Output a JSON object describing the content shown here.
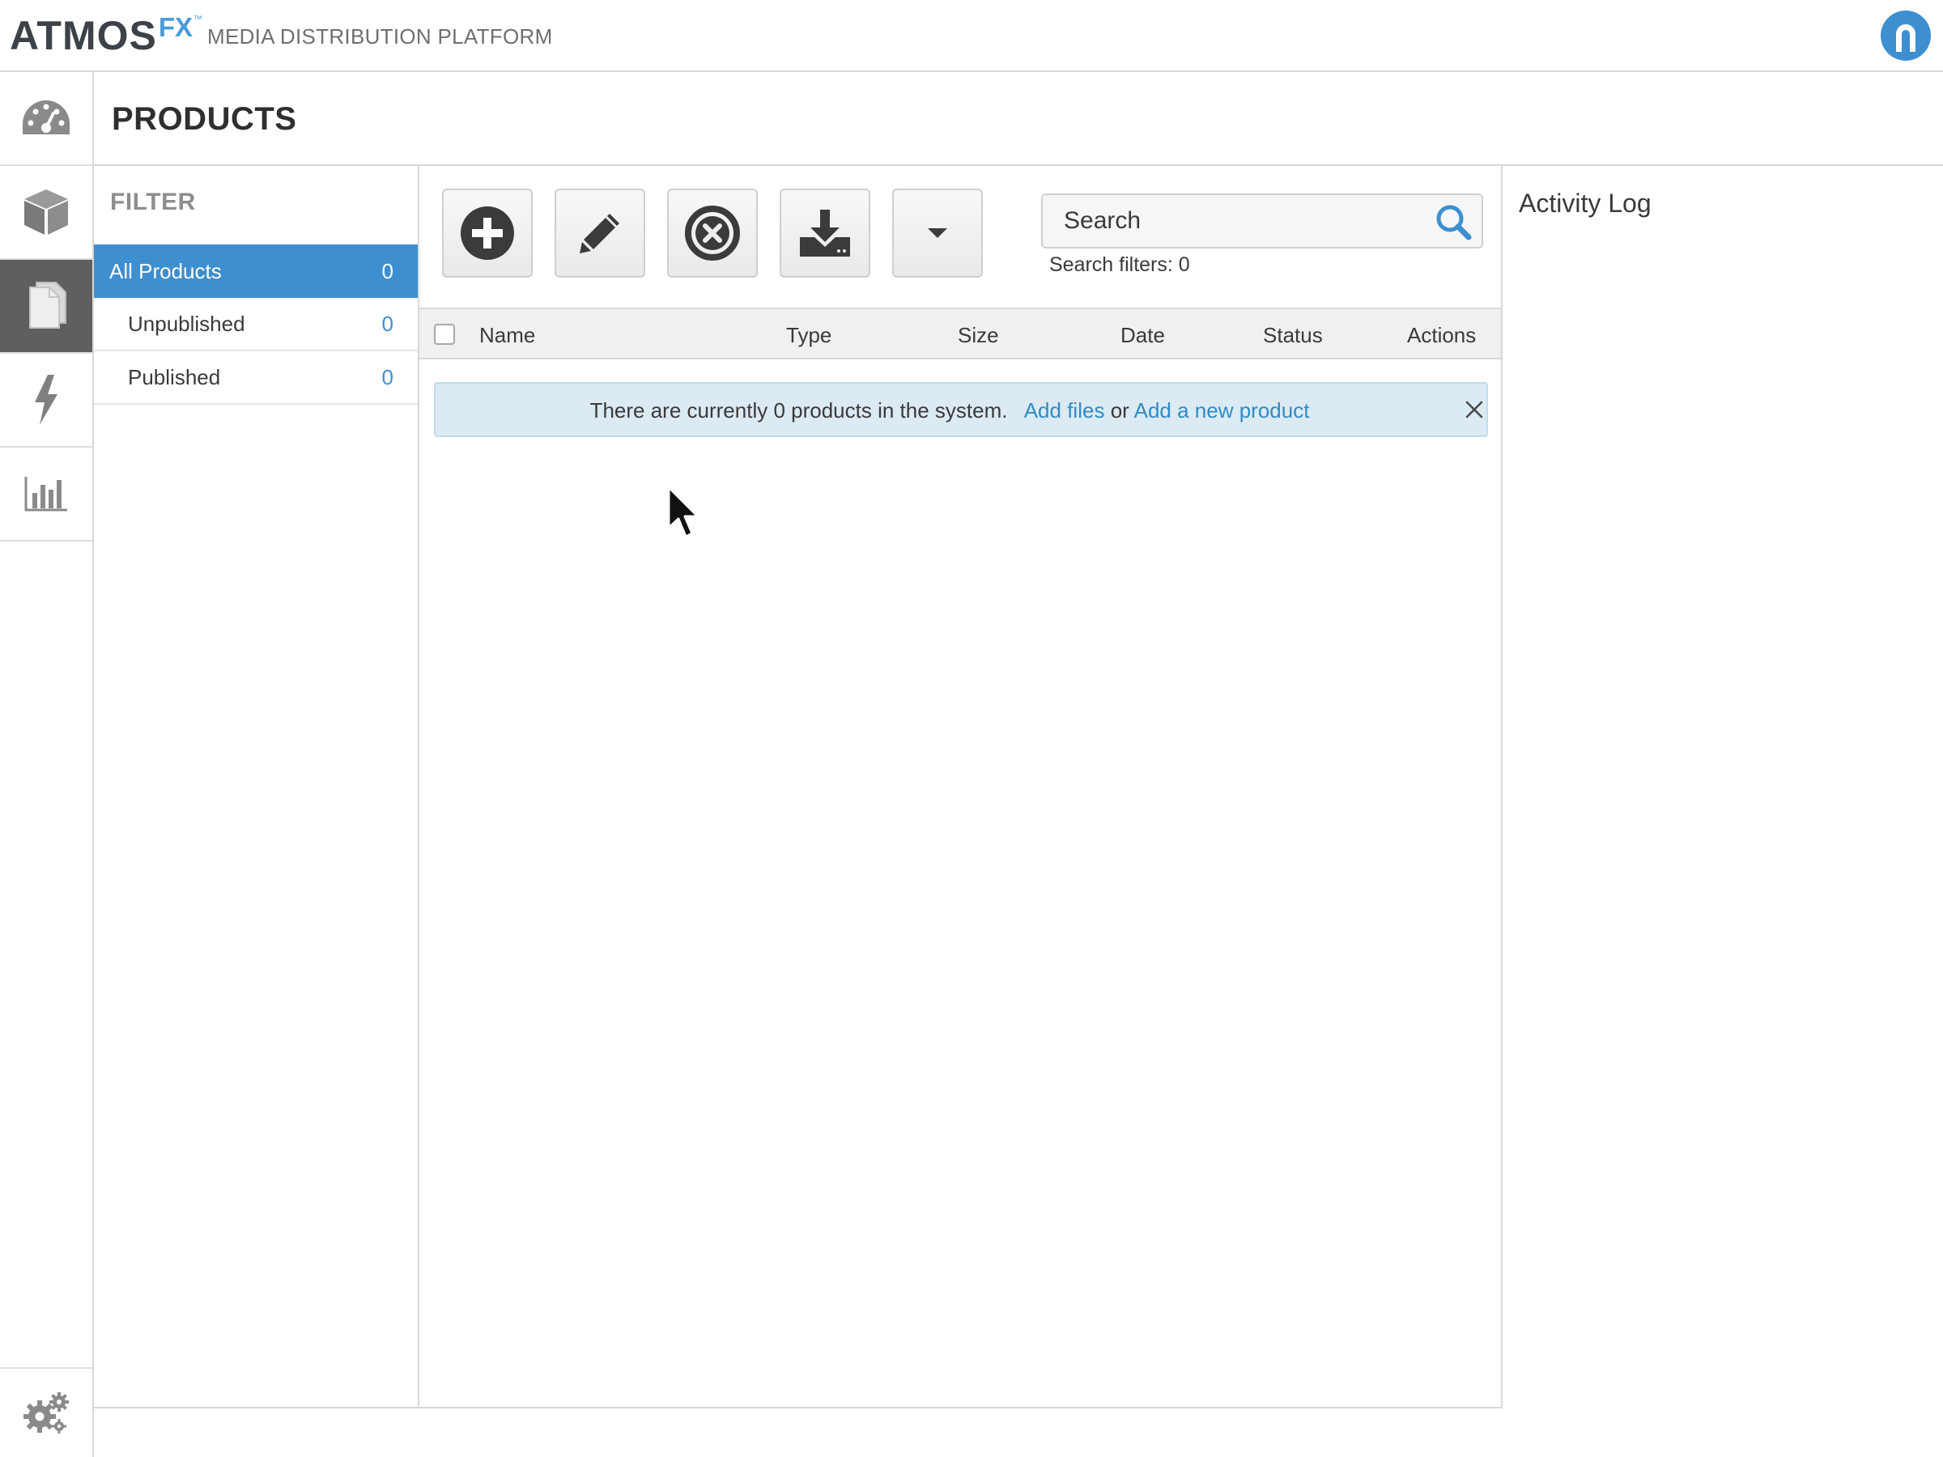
{
  "header": {
    "logo_main": "ATMOS",
    "logo_fx": "FX",
    "logo_tm": "™",
    "platform": "MEDIA DISTRIBUTION PLATFORM",
    "user_icon": "user-avatar-icon"
  },
  "rail": {
    "items": [
      {
        "icon": "dashboard-icon",
        "active": false
      },
      {
        "icon": "box-icon",
        "active": false
      },
      {
        "icon": "documents-icon",
        "active": true
      },
      {
        "icon": "lightning-icon",
        "active": false
      },
      {
        "icon": "bar-chart-icon",
        "active": false
      }
    ],
    "settings_icon": "gears-icon"
  },
  "page": {
    "title": "PRODUCTS"
  },
  "filter": {
    "heading": "FILTER",
    "items": [
      {
        "label": "All Products",
        "count": "0",
        "active": true
      },
      {
        "label": "Unpublished",
        "count": "0",
        "active": false
      },
      {
        "label": "Published",
        "count": "0",
        "active": false
      }
    ]
  },
  "toolbar": {
    "buttons": [
      {
        "icon": "add-circle-icon"
      },
      {
        "icon": "pencil-icon"
      },
      {
        "icon": "remove-circle-icon"
      },
      {
        "icon": "download-icon"
      },
      {
        "icon": "caret-down-icon"
      }
    ],
    "search_placeholder": "Search",
    "search_filters": "Search filters: 0"
  },
  "table": {
    "columns": [
      "Name",
      "Type",
      "Size",
      "Date",
      "Status",
      "Actions"
    ]
  },
  "notice": {
    "text": "There are currently 0 products in the system.",
    "link_add_files": "Add files",
    "or": "or",
    "link_add_product": "Add a new product",
    "close": "×"
  },
  "activity": {
    "title": "Activity Log"
  },
  "colors": {
    "accent": "#3d8fcf",
    "rail_active": "#5f5f5f",
    "notice_bg": "#dbeaf3",
    "link": "#2f8bc4",
    "logo_dark": "#3d4148",
    "logo_fx": "#4a9bd9"
  }
}
